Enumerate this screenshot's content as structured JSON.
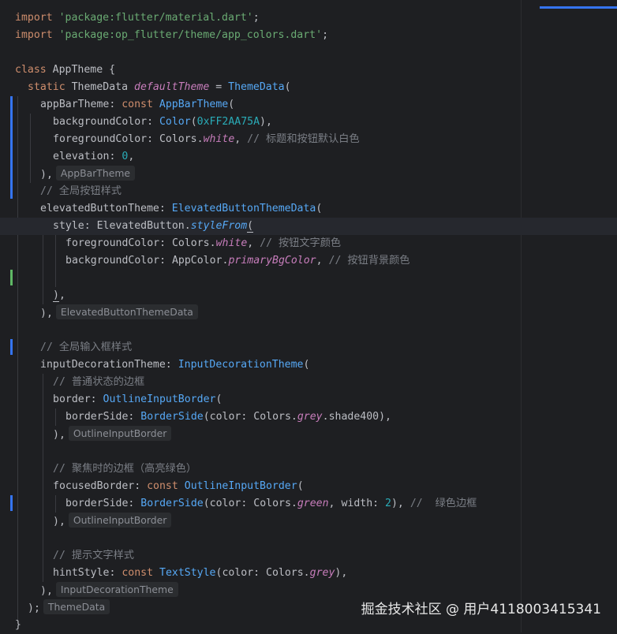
{
  "code": {
    "import1_kw": "import",
    "import1_path": "'package:flutter/material.dart'",
    "import2_kw": "import",
    "import2_path": "'package:op_flutter/theme/app_colors.dart'",
    "class_kw": "class",
    "class_name": "AppTheme",
    "static_kw": "static",
    "theme_data_type": "ThemeData",
    "default_theme": "defaultTheme",
    "theme_data_ctor": "ThemeData",
    "appbar_theme_prop": "appBarTheme",
    "const_kw": "const",
    "appbar_theme_ctor": "AppBarTheme",
    "bg_color_prop": "backgroundColor",
    "color_ctor": "Color",
    "color_value": "0xFF2AA75A",
    "fg_color_prop": "foregroundColor",
    "colors_cls": "Colors",
    "white": "white",
    "comment_fg": "// 标题和按钮默认白色",
    "elevation_prop": "elevation",
    "elevation_value": "0",
    "hint_appbartheme": "AppBarTheme",
    "comment_global_btn": "// 全局按钮样式",
    "elevated_btn_theme_prop": "elevatedButtonTheme",
    "elevated_btn_theme_ctor": "ElevatedButtonThemeData",
    "style_prop": "style",
    "elevated_button_cls": "ElevatedButton",
    "style_from": "styleFrom",
    "comment_btn_text_color": "// 按钮文字颜色",
    "app_color_cls": "AppColor",
    "primary_bg_color": "primaryBgColor",
    "comment_btn_bg_color": "// 按钮背景颜色",
    "hint_elevated": "ElevatedButtonThemeData",
    "comment_global_input": "// 全局输入框样式",
    "input_dec_theme_prop": "inputDecorationTheme",
    "input_dec_theme_ctor": "InputDecorationTheme",
    "comment_normal_border": "// 普通状态的边框",
    "border_prop": "border",
    "outline_input_border": "OutlineInputBorder",
    "border_side_prop": "borderSide",
    "border_side_ctor": "BorderSide",
    "color_named": "color",
    "grey": "grey",
    "shade400": "shade400",
    "hint_outline1": "OutlineInputBorder",
    "comment_focused": "// 聚焦时的边框（高亮绿色）",
    "focused_border_prop": "focusedBorder",
    "green": "green",
    "width_named": "width",
    "width_value": "2",
    "comment_green_border": "//  绿色边框",
    "hint_outline2": "OutlineInputBorder",
    "comment_hint_style": "// 提示文字样式",
    "hint_style_prop": "hintStyle",
    "text_style_ctor": "TextStyle",
    "grey2": "grey",
    "hint_input_dec": "InputDecorationTheme",
    "hint_themedata": "ThemeData"
  },
  "watermark": "掘金技术社区 @ 用户4118003415341",
  "colors": {
    "background": "#1e1f22",
    "keyword": "#cf8e6d",
    "string": "#6aab73",
    "number": "#2aacb8",
    "function": "#56a8f5",
    "static_member": "#c77dbb",
    "comment": "#7a7e85",
    "gutter_modified": "#3574f0",
    "gutter_added": "#5fb865"
  }
}
